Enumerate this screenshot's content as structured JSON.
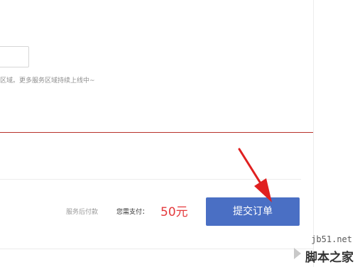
{
  "form": {
    "address_input_value": "",
    "service_area_hint": "区域。更多服务区域持续上线中~"
  },
  "order": {
    "pay_after_service_label": "服务后付款",
    "amount_due_label": "您需支付：",
    "amount_due_value": "50元",
    "submit_label": "提交订单"
  },
  "annotation": {
    "arrow_color": "#e02020"
  },
  "watermark": {
    "site": "jb51.net",
    "name": "脚本之家"
  },
  "colors": {
    "accent_button": "#4a6fc4",
    "price_red": "#e4393c",
    "divider_red": "#b8322a"
  }
}
